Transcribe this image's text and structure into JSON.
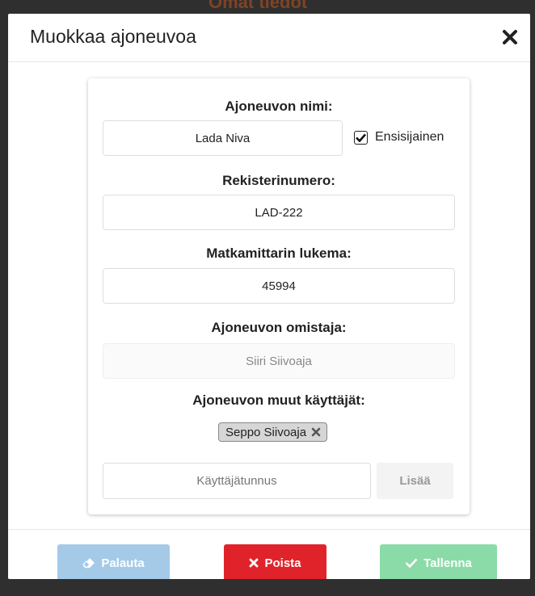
{
  "backdrop": {
    "text": "Omat tiedot"
  },
  "modal": {
    "title": "Muokkaa ajoneuvoa"
  },
  "form": {
    "vehicle_name_label": "Ajoneuvon nimi:",
    "vehicle_name_value": "Lada Niva",
    "primary_label": "Ensisijainen",
    "primary_checked": true,
    "registration_label": "Rekisterinumero:",
    "registration_value": "LAD-222",
    "odometer_label": "Matkamittarin lukema:",
    "odometer_value": "45994",
    "owner_label": "Ajoneuvon omistaja:",
    "owner_value": "Siiri Siivoaja",
    "other_users_label": "Ajoneuvon muut käyttäjät:",
    "other_users": [
      "Seppo Siivoaja"
    ],
    "username_placeholder": "Käyttäjätunnus",
    "add_label": "Lisää"
  },
  "footer": {
    "reset_label": "Palauta",
    "delete_label": "Poista",
    "save_label": "Tallenna"
  },
  "colors": {
    "reset": "#a4cae8",
    "delete": "#e0232b",
    "save": "#8bdba8"
  }
}
